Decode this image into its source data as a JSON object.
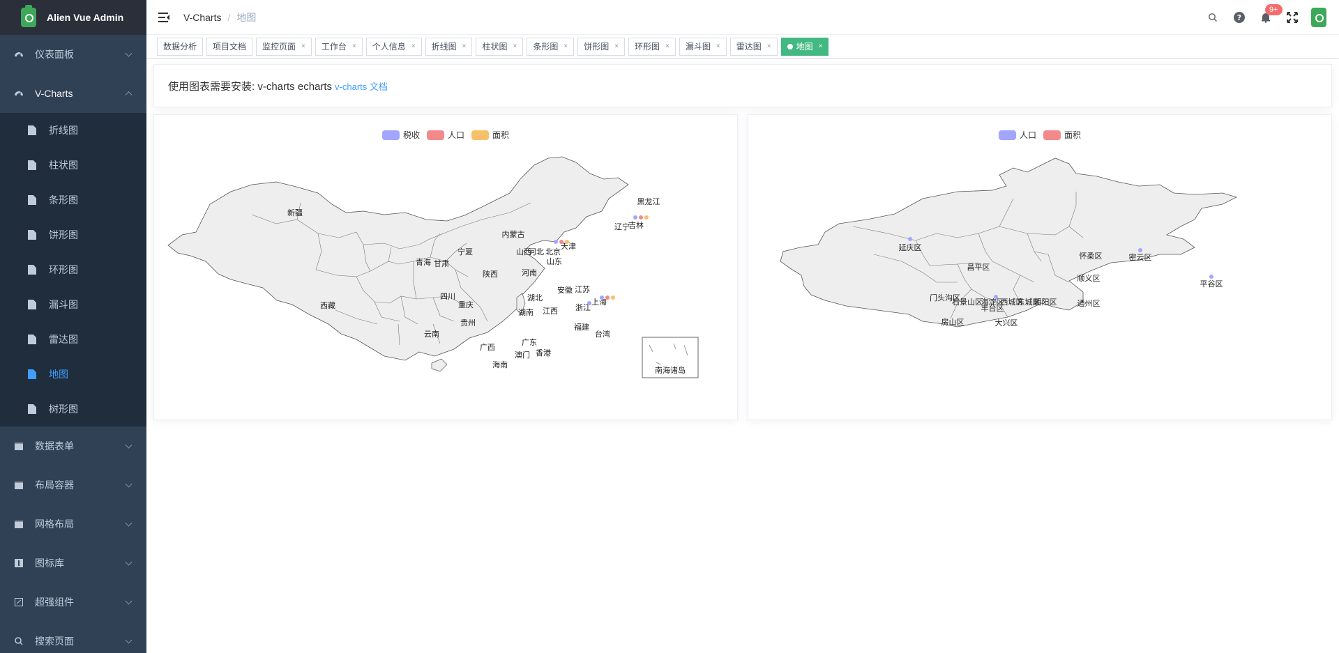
{
  "app": {
    "title": "Alien Vue Admin"
  },
  "sidebar": {
    "menus": [
      {
        "label": "仪表面板",
        "icon": "dashboard-icon",
        "open": false
      },
      {
        "label": "V-Charts",
        "icon": "dashboard-icon",
        "open": true
      }
    ],
    "vcharts_items": [
      "折线图",
      "柱状图",
      "条形图",
      "饼形图",
      "环形图",
      "漏斗图",
      "雷达图",
      "地图",
      "树形图"
    ],
    "active_item": "地图",
    "lower_menus": [
      {
        "label": "数据表单",
        "icon": "table-icon"
      },
      {
        "label": "布局容器",
        "icon": "layout-icon"
      },
      {
        "label": "网格布局",
        "icon": "grid-icon"
      },
      {
        "label": "图标库",
        "icon": "icon-library-icon"
      },
      {
        "label": "超强组件",
        "icon": "component-icon"
      },
      {
        "label": "搜索页面",
        "icon": "search-icon"
      }
    ]
  },
  "navbar": {
    "breadcrumb": [
      "V-Charts",
      "地图"
    ],
    "badge": "9+"
  },
  "tags": [
    {
      "label": "数据分析",
      "closable": false
    },
    {
      "label": "项目文档",
      "closable": false
    },
    {
      "label": "监控页面",
      "closable": true
    },
    {
      "label": "工作台",
      "closable": true
    },
    {
      "label": "个人信息",
      "closable": true
    },
    {
      "label": "折线图",
      "closable": true
    },
    {
      "label": "柱状图",
      "closable": true
    },
    {
      "label": "条形图",
      "closable": true
    },
    {
      "label": "饼形图",
      "closable": true
    },
    {
      "label": "环形图",
      "closable": true
    },
    {
      "label": "漏斗图",
      "closable": true
    },
    {
      "label": "雷达图",
      "closable": true
    },
    {
      "label": "地图",
      "closable": true,
      "active": true
    }
  ],
  "info": {
    "text": "使用图表需要安装: v-charts echarts",
    "link": "v-charts 文档"
  },
  "chart_data": [
    {
      "type": "map",
      "region": "china",
      "legend": [
        "税收",
        "人口",
        "面积"
      ],
      "legend_colors": [
        "#a3a6ff",
        "#f28a8c",
        "#f7c06a"
      ],
      "labels": [
        "新疆",
        "西藏",
        "青海",
        "甘肃",
        "宁夏",
        "内蒙古",
        "黑龙江",
        "吉林",
        "辽宁",
        "北京",
        "天津",
        "河北",
        "山西",
        "陕西",
        "山东",
        "河南",
        "江苏",
        "安徽",
        "上海",
        "浙江",
        "湖北",
        "四川",
        "重庆",
        "贵州",
        "湖南",
        "江西",
        "福建",
        "台湾",
        "云南",
        "广西",
        "广东",
        "香港",
        "澳门",
        "海南",
        "南海诸岛"
      ],
      "marked_regions": [
        "吉林",
        "北京",
        "上海"
      ]
    },
    {
      "type": "map",
      "region": "beijing",
      "legend": [
        "人口",
        "面积"
      ],
      "legend_colors": [
        "#a3a6ff",
        "#f28a8c"
      ],
      "labels": [
        "延庆区",
        "怀柔区",
        "密云区",
        "昌平区",
        "顺义区",
        "平谷区",
        "门头沟区",
        "石景山区",
        "海淀区",
        "丰台区",
        "西城区",
        "东城区",
        "朝阳区",
        "通州区",
        "房山区",
        "大兴区"
      ],
      "marked_regions": [
        "延庆区",
        "密云区",
        "平谷区",
        "海淀区"
      ]
    }
  ]
}
